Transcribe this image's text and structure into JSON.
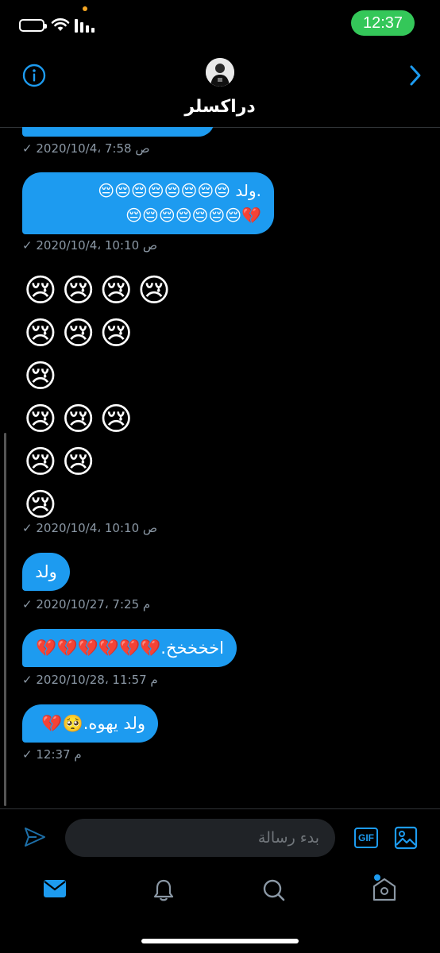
{
  "status_bar": {
    "time": "12:37"
  },
  "header": {
    "title": "دراكسلر"
  },
  "messages": [
    {
      "type": "stamp",
      "time": "2020/10/4، 7:58 ص"
    },
    {
      "type": "bubble",
      "line1": ".ولد 😔😔😔😔😔😔😔😔",
      "line2": "💔😔😔😔😔😔😔😔"
    },
    {
      "type": "stamp",
      "time": "2020/10/4، 10:10 ص"
    },
    {
      "type": "emoji_block",
      "rows": [
        "😢😢😢😢",
        "😢😢😢",
        "😢",
        "😢😢😢",
        "😢😢",
        "😢"
      ]
    },
    {
      "type": "stamp",
      "time": "2020/10/4، 10:10 ص"
    },
    {
      "type": "bubble",
      "text": "ولد"
    },
    {
      "type": "stamp",
      "time": "2020/10/27، 7:25 م"
    },
    {
      "type": "bubble",
      "text": "اخخخخخ.💔💔💔💔💔💔"
    },
    {
      "type": "stamp",
      "time": "2020/10/28، 11:57 م"
    },
    {
      "type": "bubble",
      "text": "ولد يهوه.🥺💔"
    },
    {
      "type": "stamp",
      "time": "12:37 م"
    }
  ],
  "composer": {
    "placeholder": "بدء رسالة",
    "gif_label": "GIF"
  },
  "icons": {
    "info": "info-circle-icon",
    "back": "chevron-right-icon",
    "send": "send-icon",
    "image": "image-icon",
    "tabs": [
      "mail-icon",
      "bell-icon",
      "search-icon",
      "home-icon"
    ]
  },
  "colors": {
    "accent": "#1d9bf0",
    "background": "#000000",
    "time_pill": "#34c759",
    "muted": "#8b98a5"
  }
}
